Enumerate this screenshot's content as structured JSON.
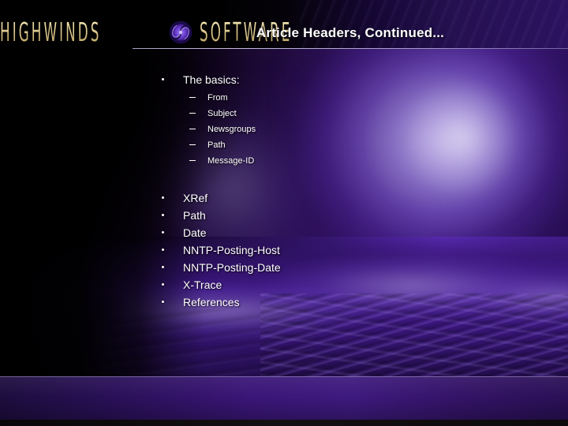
{
  "slide": {
    "title": "Article Headers, Continued...",
    "brand": {
      "word_left": "HIGHWINDS",
      "word_right": "SOFTWARE",
      "logo_icon": "spiral-galaxy-icon",
      "gold_hex": "#e8d9a0"
    },
    "theme": {
      "background_hex": "#000000",
      "accent_purple_hex": "#3d1a7e",
      "text_hex": "#ffffff",
      "rule_hex": "#c4bce2",
      "background_image": "purple-ocean-wave-photo"
    },
    "content": {
      "groups": [
        {
          "bullet": "The basics:",
          "sub_bullets": [
            "From",
            "Subject",
            "Newsgroups",
            "Path",
            "Message-ID"
          ]
        },
        {
          "bullet": null,
          "sub_bullets": []
        }
      ],
      "second_list": [
        "XRef",
        "Path",
        "Date",
        "NNTP-Posting-Host",
        "NNTP-Posting-Date",
        "X-Trace",
        "References"
      ]
    }
  }
}
